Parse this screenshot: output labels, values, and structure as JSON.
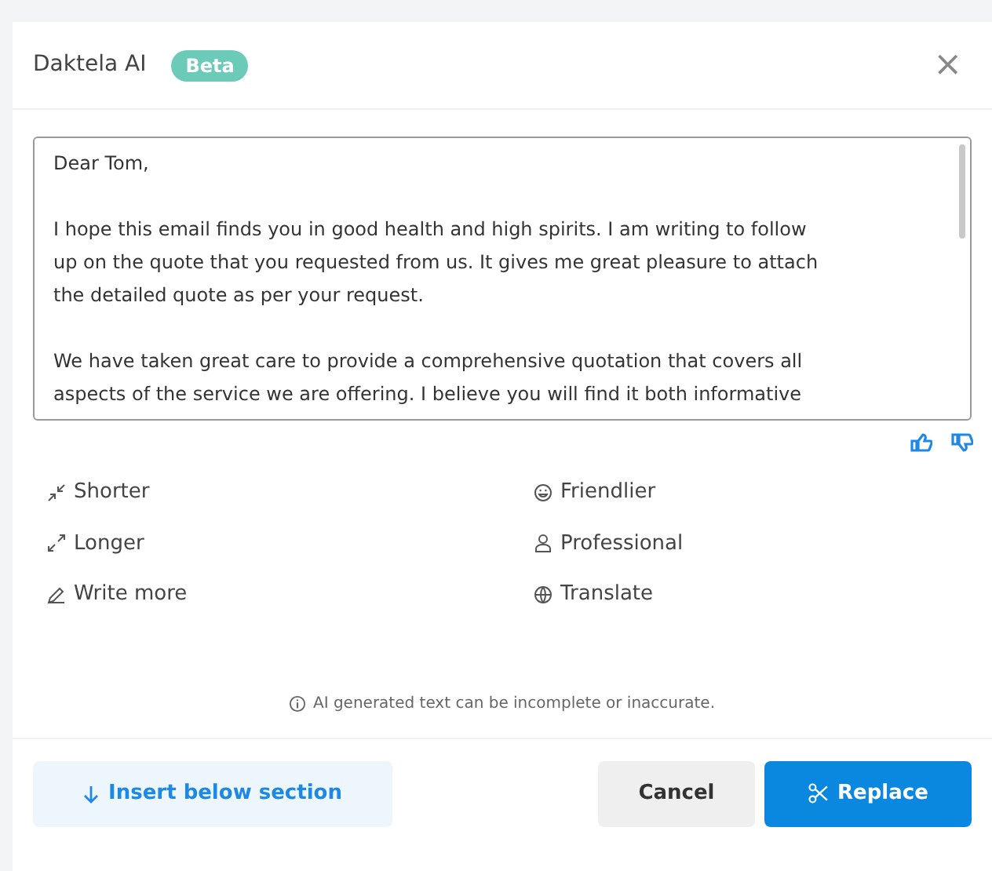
{
  "dialog": {
    "title": "Daktela AI",
    "badge": "Beta",
    "close": "×"
  },
  "editor": {
    "paragraphs": [
      [
        "Dear Tom,"
      ],
      [
        "I hope this email finds you in good health and high spirits. I am writing to follow",
        "up on the quote that you requested from us. It gives me great pleasure to attach",
        "the detailed quote as per your request."
      ],
      [
        "We have taken great care to provide a comprehensive quotation that covers all",
        "aspects of the service we are offering. I believe you will find it both informative"
      ]
    ]
  },
  "actions": [
    {
      "kind": "shorter",
      "label": "Shorter"
    },
    {
      "kind": "friendlier",
      "label": "Friendlier"
    },
    {
      "kind": "longer",
      "label": "Longer"
    },
    {
      "kind": "professional",
      "label": "Professional"
    },
    {
      "kind": "write_more",
      "label": "Write more"
    },
    {
      "kind": "translate",
      "label": "Translate"
    }
  ],
  "disclaimer": "AI generated text can be incomplete or inaccurate.",
  "buttons": [
    {
      "kind": "insert",
      "label": "Insert below section"
    },
    {
      "kind": "cancel",
      "label": "Cancel"
    },
    {
      "kind": "replace",
      "label": "Replace"
    }
  ]
}
